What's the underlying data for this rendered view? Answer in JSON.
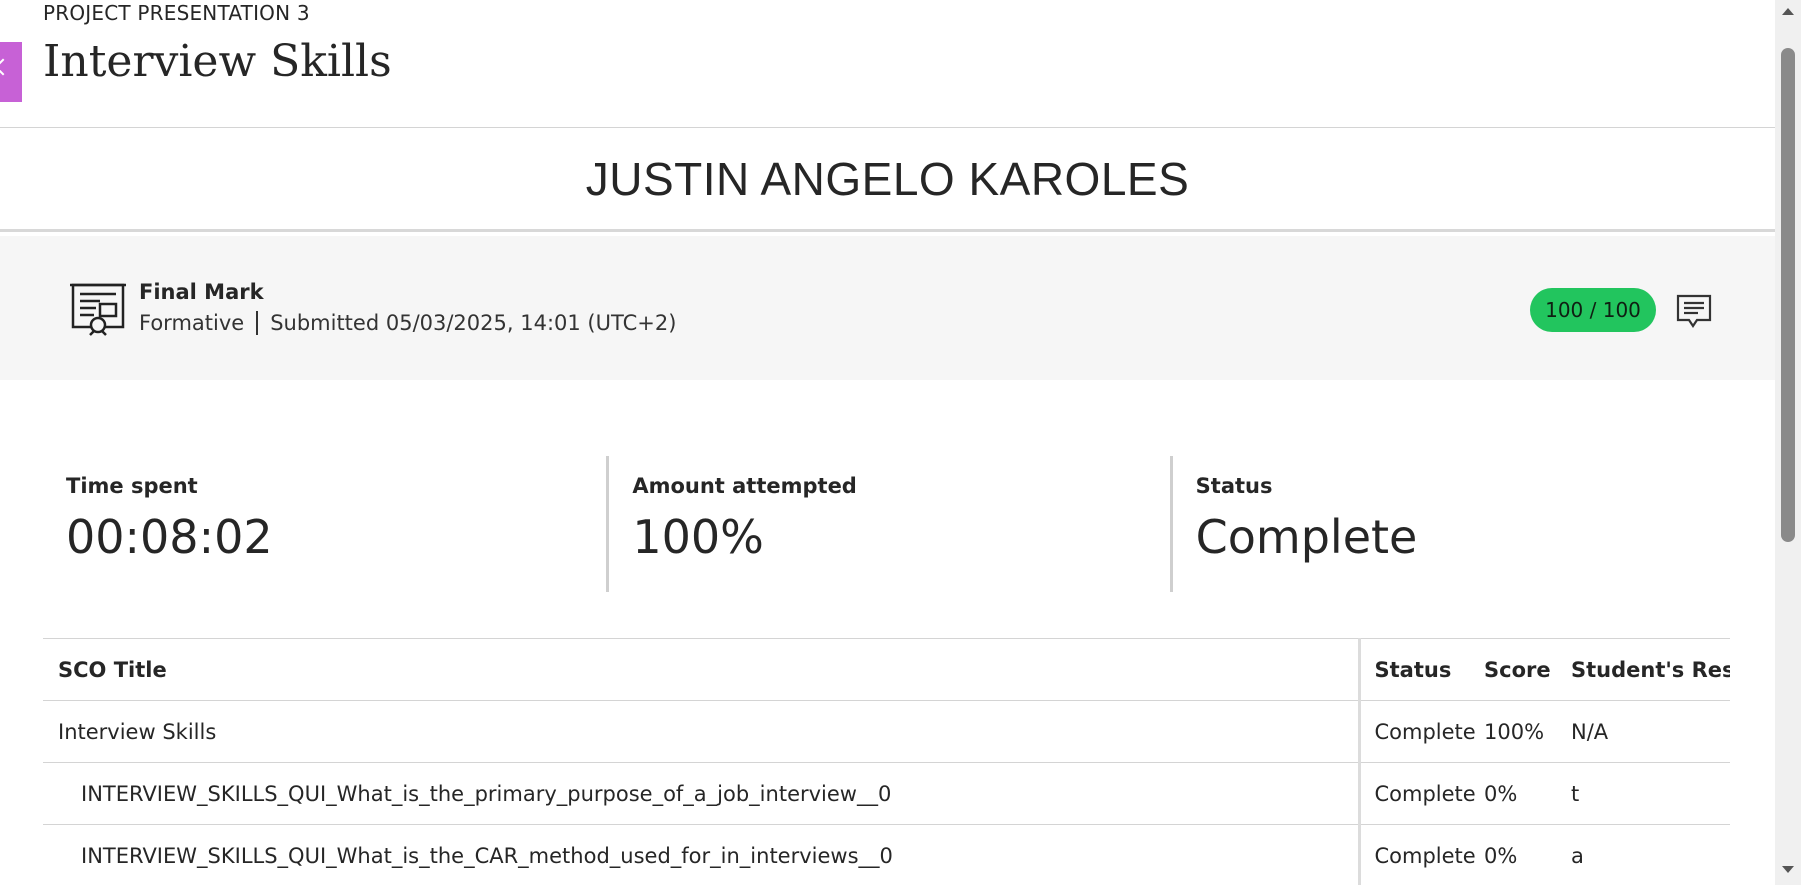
{
  "header": {
    "breadcrumb": "PROJECT PRESENTATION 3",
    "title": "Interview Skills"
  },
  "student": {
    "name": "JUSTIN ANGELO KAROLES"
  },
  "final_mark": {
    "title": "Final Mark",
    "type": "Formative",
    "submitted": "Submitted 05/03/2025, 14:01 (UTC+2)",
    "score": "100 / 100",
    "score_color": "#22c55e",
    "icon": "presentation-certificate-icon",
    "comment_icon": "comment-icon"
  },
  "stats": [
    {
      "label": "Time spent",
      "value": "00:08:02"
    },
    {
      "label": "Amount attempted",
      "value": "100%"
    },
    {
      "label": "Status",
      "value": "Complete"
    }
  ],
  "table": {
    "headers": [
      "SCO Title",
      "Status",
      "Score",
      "Student's Resp"
    ],
    "rows": [
      {
        "title": "Interview Skills",
        "status": "Complete",
        "score": "100%",
        "response": "N/A"
      },
      {
        "title": "INTERVIEW_SKILLS_QUI_What_is_the_primary_purpose_of_a_job_interview__0",
        "status": "Complete",
        "score": "0%",
        "response": "t"
      },
      {
        "title": "INTERVIEW_SKILLS_QUI_What_is_the_CAR_method_used_for_in_interviews__0",
        "status": "Complete",
        "score": "0%",
        "response": "a"
      }
    ]
  },
  "colors": {
    "accent_tab": "#c761d6",
    "badge": "#22c55e"
  }
}
